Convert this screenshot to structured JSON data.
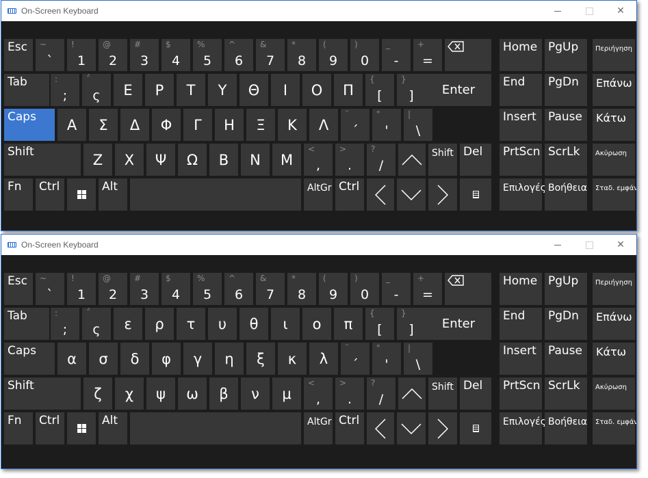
{
  "windows": [
    {
      "title": "On-Screen Keyboard",
      "rows": [
        [
          {
            "label": "Esc"
          },
          {
            "sec": "~",
            "pri": "`"
          },
          {
            "sec": "!",
            "pri": "1"
          },
          {
            "sec": "@",
            "pri": "2"
          },
          {
            "sec": "#",
            "pri": "3"
          },
          {
            "sec": "$",
            "pri": "4"
          },
          {
            "sec": "%",
            "pri": "5"
          },
          {
            "sec": "^",
            "pri": "6"
          },
          {
            "sec": "&",
            "pri": "7"
          },
          {
            "sec": "*",
            "pri": "8"
          },
          {
            "sec": "(",
            "pri": "9"
          },
          {
            "sec": ")",
            "pri": "0"
          },
          {
            "sec": "_",
            "pri": "-"
          },
          {
            "sec": "+",
            "pri": "="
          },
          {
            "icon": "backspace-icon"
          },
          {
            "label": "Home"
          },
          {
            "label": "PgUp"
          },
          {
            "label": "Περιήγηση"
          }
        ],
        [
          {
            "label": "Tab"
          },
          {
            "sec": ":",
            "pri": ";"
          },
          {
            "sec": "΅",
            "pri": "ς"
          },
          {
            "char": "Ε"
          },
          {
            "char": "Ρ"
          },
          {
            "char": "Τ"
          },
          {
            "char": "Υ"
          },
          {
            "char": "Θ"
          },
          {
            "char": "Ι"
          },
          {
            "char": "Ο"
          },
          {
            "char": "Π"
          },
          {
            "sec": "{",
            "pri": "["
          },
          {
            "sec": "}",
            "pri": "]"
          },
          {
            "label": "Enter"
          },
          {
            "label": "End"
          },
          {
            "label": "PgDn"
          },
          {
            "label": "Επάνω"
          }
        ],
        [
          {
            "label": "Caps"
          },
          {
            "char": "Α"
          },
          {
            "char": "Σ"
          },
          {
            "char": "Δ"
          },
          {
            "char": "Φ"
          },
          {
            "char": "Γ"
          },
          {
            "char": "Η"
          },
          {
            "char": "Ξ"
          },
          {
            "char": "Κ"
          },
          {
            "char": "Λ"
          },
          {
            "sec": "¨",
            "pri": "΄"
          },
          {
            "sec": "\"",
            "pri": "'"
          },
          {
            "sec": "|",
            "pri": "\\"
          },
          {
            "label": "Insert"
          },
          {
            "label": "Pause"
          },
          {
            "label": "Κάτω"
          }
        ],
        [
          {
            "label": "Shift"
          },
          {
            "char": "Ζ"
          },
          {
            "char": "Χ"
          },
          {
            "char": "Ψ"
          },
          {
            "char": "Ω"
          },
          {
            "char": "Β"
          },
          {
            "char": "Ν"
          },
          {
            "char": "Μ"
          },
          {
            "sec": "<",
            "pri": ","
          },
          {
            "sec": ">",
            "pri": "."
          },
          {
            "sec": "?",
            "pri": "/"
          },
          {
            "icon": "up-arrow-icon"
          },
          {
            "label": "Shift"
          },
          {
            "label": "Del"
          },
          {
            "label": "PrtScn"
          },
          {
            "label": "ScrLk"
          },
          {
            "label": "Ακύρωση"
          }
        ],
        [
          {
            "label": "Fn"
          },
          {
            "label": "Ctrl"
          },
          {
            "icon": "windows-logo-icon"
          },
          {
            "label": "Alt"
          },
          {
            "label": ""
          },
          {
            "label": "AltGr"
          },
          {
            "label": "Ctrl"
          },
          {
            "icon": "left-arrow-icon"
          },
          {
            "icon": "down-arrow-icon"
          },
          {
            "icon": "right-arrow-icon"
          },
          {
            "icon": "menu-key-icon"
          },
          {
            "label": "Επιλογές"
          },
          {
            "label": "Βοήθεια"
          },
          {
            "label": "Σταδ. εμφάνιση"
          }
        ]
      ]
    },
    {
      "title": "On-Screen Keyboard",
      "rows": [
        [
          {
            "label": "Esc"
          },
          {
            "sec": "~",
            "pri": "`"
          },
          {
            "sec": "!",
            "pri": "1"
          },
          {
            "sec": "@",
            "pri": "2"
          },
          {
            "sec": "#",
            "pri": "3"
          },
          {
            "sec": "$",
            "pri": "4"
          },
          {
            "sec": "%",
            "pri": "5"
          },
          {
            "sec": "^",
            "pri": "6"
          },
          {
            "sec": "&",
            "pri": "7"
          },
          {
            "sec": "*",
            "pri": "8"
          },
          {
            "sec": "(",
            "pri": "9"
          },
          {
            "sec": ")",
            "pri": "0"
          },
          {
            "sec": "_",
            "pri": "-"
          },
          {
            "sec": "+",
            "pri": "="
          },
          {
            "icon": "backspace-icon"
          },
          {
            "label": "Home"
          },
          {
            "label": "PgUp"
          },
          {
            "label": "Περιήγηση"
          }
        ],
        [
          {
            "label": "Tab"
          },
          {
            "sec": ":",
            "pri": ";"
          },
          {
            "sec": "΅",
            "pri": "ς"
          },
          {
            "char": "ε"
          },
          {
            "char": "ρ"
          },
          {
            "char": "τ"
          },
          {
            "char": "υ"
          },
          {
            "char": "θ"
          },
          {
            "char": "ι"
          },
          {
            "char": "ο"
          },
          {
            "char": "π"
          },
          {
            "sec": "{",
            "pri": "["
          },
          {
            "sec": "}",
            "pri": "]"
          },
          {
            "label": "Enter"
          },
          {
            "label": "End"
          },
          {
            "label": "PgDn"
          },
          {
            "label": "Επάνω"
          }
        ],
        [
          {
            "label": "Caps"
          },
          {
            "char": "α"
          },
          {
            "char": "σ"
          },
          {
            "char": "δ"
          },
          {
            "char": "φ"
          },
          {
            "char": "γ"
          },
          {
            "char": "η"
          },
          {
            "char": "ξ"
          },
          {
            "char": "κ"
          },
          {
            "char": "λ"
          },
          {
            "sec": "¨",
            "pri": "΄"
          },
          {
            "sec": "\"",
            "pri": "'"
          },
          {
            "sec": "|",
            "pri": "\\"
          },
          {
            "label": "Insert"
          },
          {
            "label": "Pause"
          },
          {
            "label": "Κάτω"
          }
        ],
        [
          {
            "label": "Shift"
          },
          {
            "char": "ζ"
          },
          {
            "char": "χ"
          },
          {
            "char": "ψ"
          },
          {
            "char": "ω"
          },
          {
            "char": "β"
          },
          {
            "char": "ν"
          },
          {
            "char": "μ"
          },
          {
            "sec": "<",
            "pri": ","
          },
          {
            "sec": ">",
            "pri": "."
          },
          {
            "sec": "?",
            "pri": "/"
          },
          {
            "icon": "up-arrow-icon"
          },
          {
            "label": "Shift"
          },
          {
            "label": "Del"
          },
          {
            "label": "PrtScn"
          },
          {
            "label": "ScrLk"
          },
          {
            "label": "Ακύρωση"
          }
        ],
        [
          {
            "label": "Fn"
          },
          {
            "label": "Ctrl"
          },
          {
            "icon": "windows-logo-icon"
          },
          {
            "label": "Alt"
          },
          {
            "label": ""
          },
          {
            "label": "AltGr"
          },
          {
            "label": "Ctrl"
          },
          {
            "icon": "left-arrow-icon"
          },
          {
            "icon": "down-arrow-icon"
          },
          {
            "icon": "right-arrow-icon"
          },
          {
            "icon": "menu-key-icon"
          },
          {
            "label": "Επιλογές"
          },
          {
            "label": "Βοήθεια"
          },
          {
            "label": "Σταδ. εμφάνιση"
          }
        ]
      ]
    }
  ],
  "colors": {
    "key": "#373737",
    "active_key": "#3c78d0",
    "background": "#1c1c1c",
    "secondary_text": "#8a8a8a"
  },
  "active_keys": {
    "window_1": "Caps"
  }
}
